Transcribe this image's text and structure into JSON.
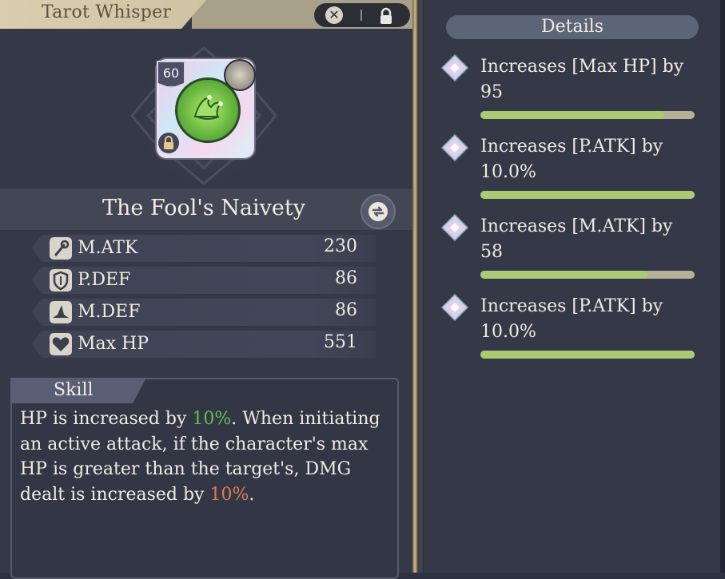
{
  "header": {
    "title": "Tarot Whisper"
  },
  "card": {
    "level": "60",
    "name": "The Fool's Naivety"
  },
  "stats": [
    {
      "icon": "wand-icon",
      "label": "M.ATK",
      "value": "230"
    },
    {
      "icon": "shield-icon",
      "label": "P.DEF",
      "value": "86"
    },
    {
      "icon": "hat-icon",
      "label": "M.DEF",
      "value": "86"
    },
    {
      "icon": "heart-icon",
      "label": "Max HP",
      "value": "551"
    }
  ],
  "skill": {
    "title": "Skill",
    "text_1": "HP is increased by ",
    "hp_bonus": "10%",
    "text_2": ". When initiating an active attack, if the character's max HP is greater than the target's, DMG dealt is increased by ",
    "dmg_bonus": "10%",
    "text_3": ".",
    "colors": {
      "hp_bonus": "#5fc04e",
      "dmg_bonus": "#e07a56"
    }
  },
  "details": {
    "title": "Details",
    "items": [
      {
        "text": "Increases [Max HP] by 95",
        "fill": 0.86
      },
      {
        "text": "Increases [P.ATK] by 10.0%",
        "fill": 1.0
      },
      {
        "text": "Increases [M.ATK] by 58",
        "fill": 0.78
      },
      {
        "text": "Increases [P.ATK] by 10.0%",
        "fill": 1.0
      }
    ]
  }
}
